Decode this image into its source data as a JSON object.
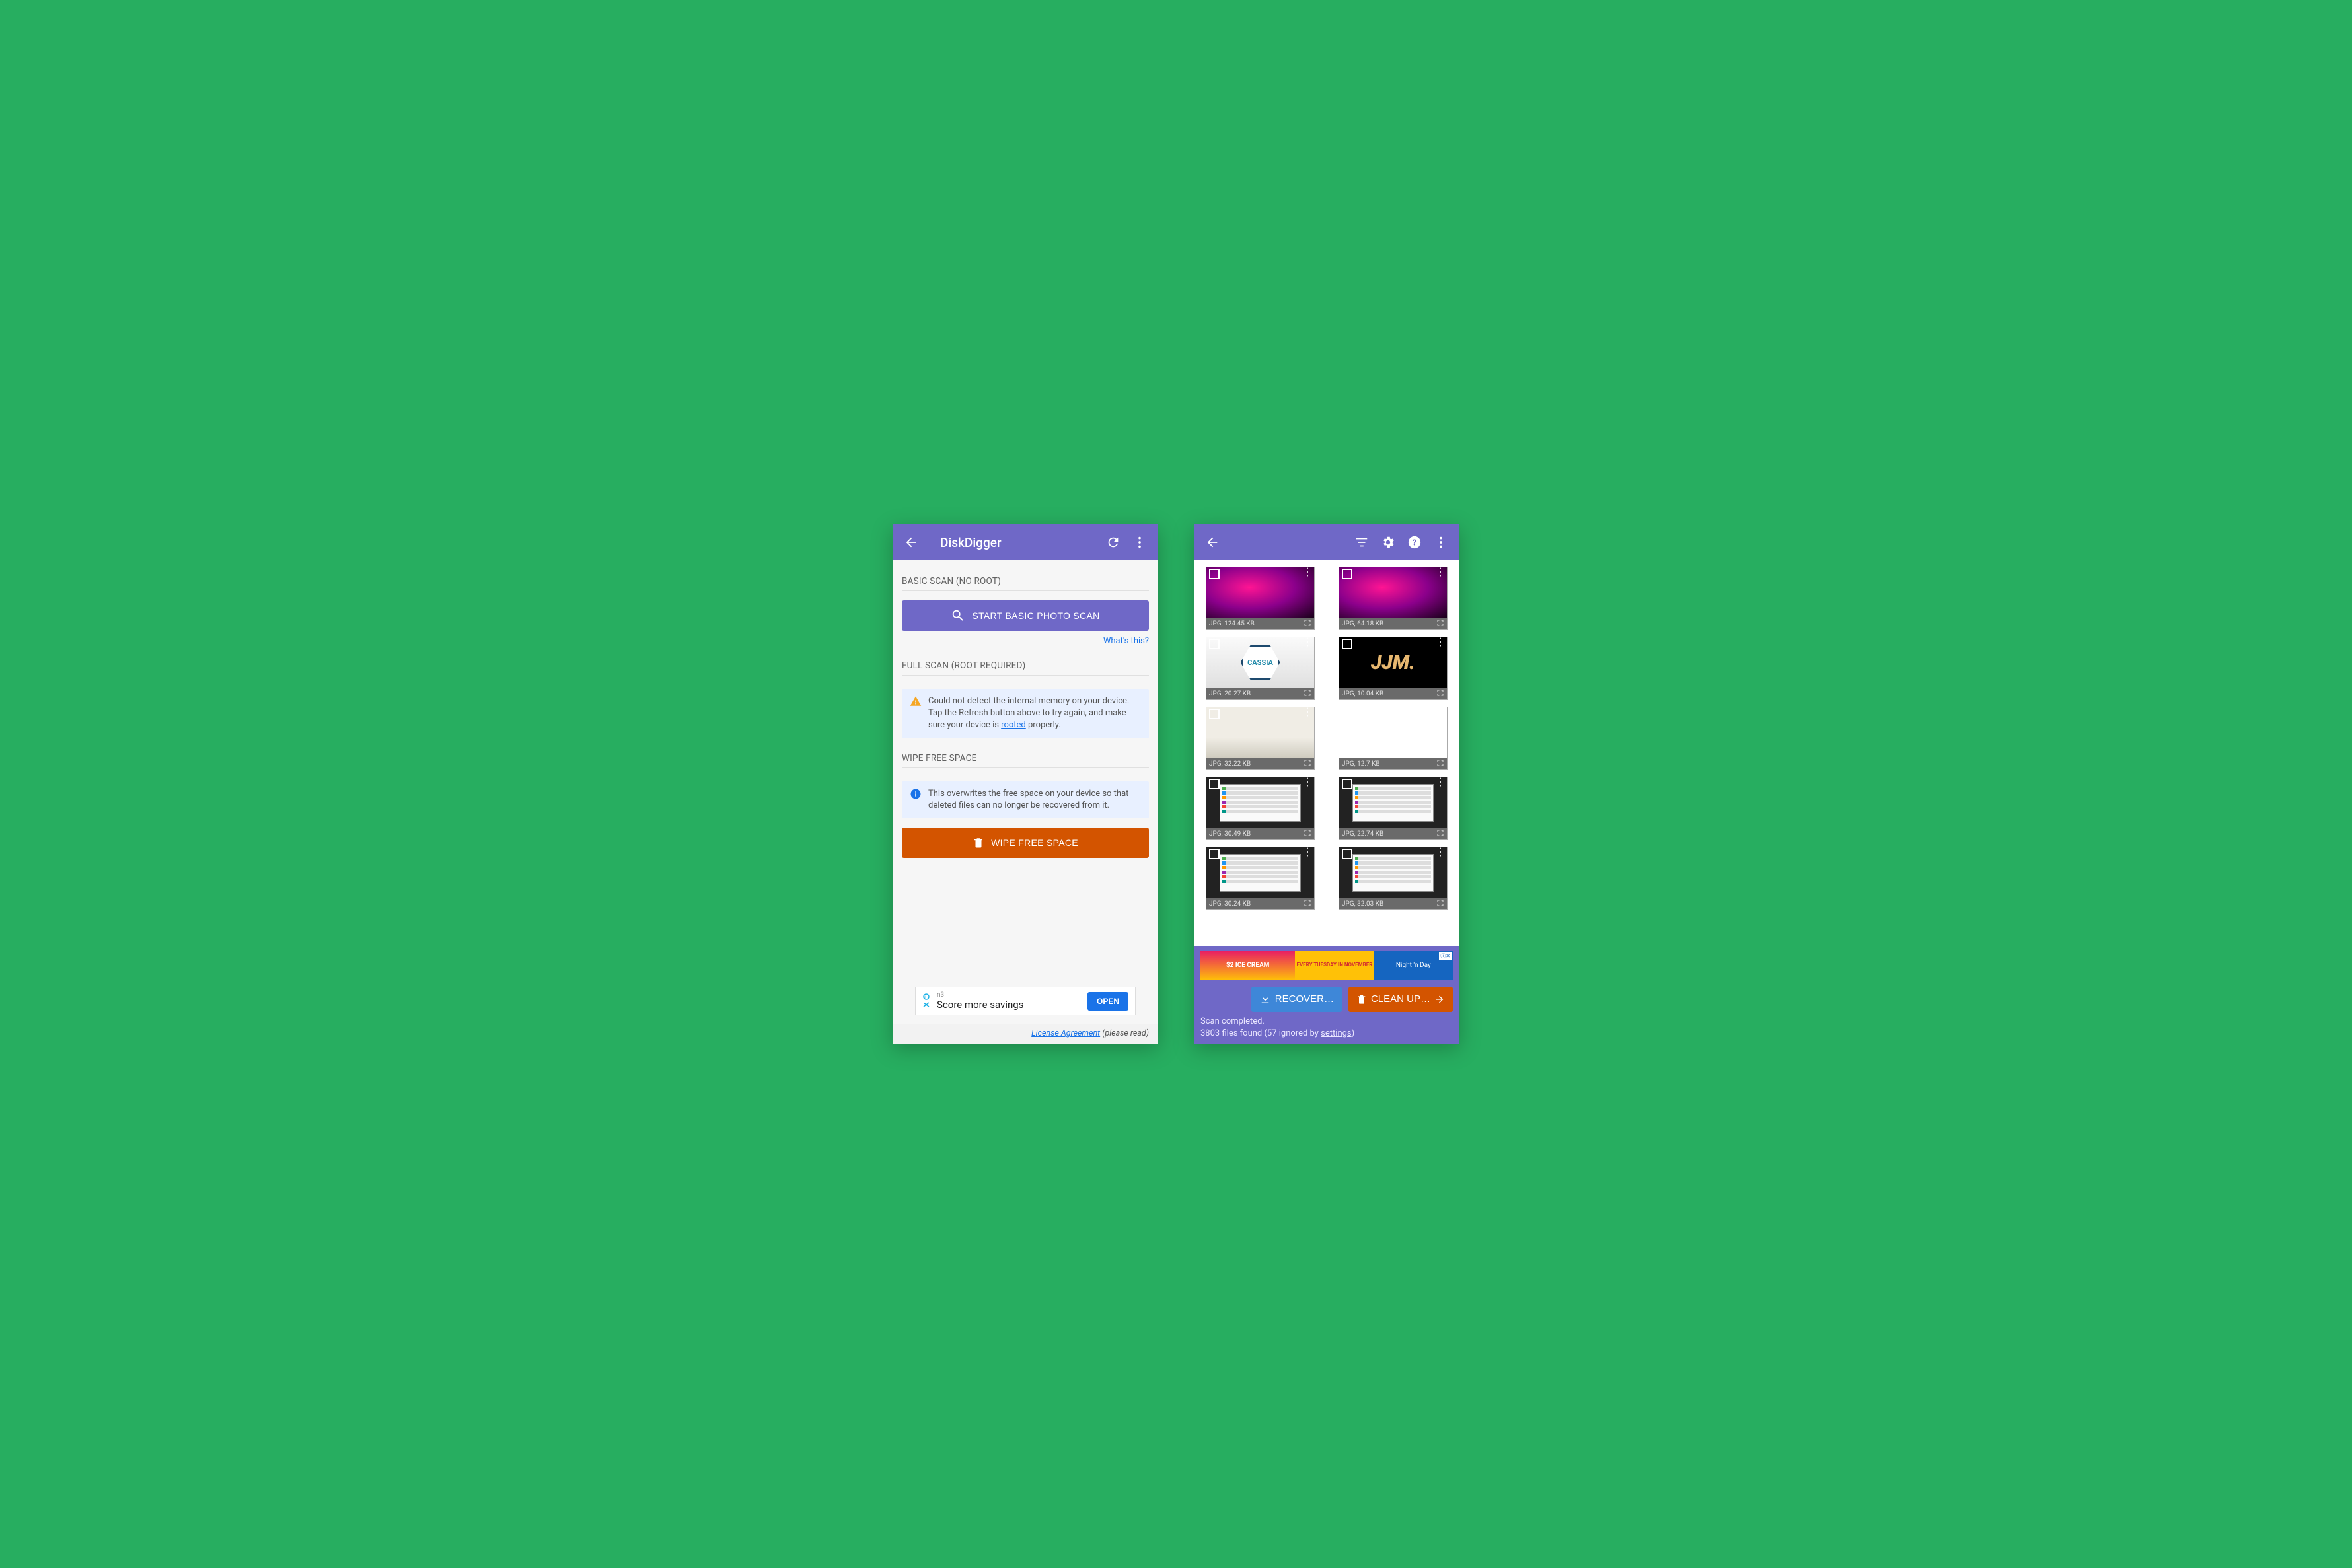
{
  "left": {
    "app_title": "DiskDigger",
    "basic": {
      "label": "BASIC SCAN (NO ROOT)",
      "button": "START BASIC PHOTO SCAN",
      "whats_this": "What's this?"
    },
    "full": {
      "label": "FULL SCAN (ROOT REQUIRED)",
      "warn_pre": "Could not detect the internal memory on your device. Tap the Refresh button above to try again, and make sure your device is ",
      "warn_link": "rooted",
      "warn_post": " properly."
    },
    "wipe": {
      "label": "WIPE FREE SPACE",
      "info": "This overwrites the free space on your device so that deleted files can no longer be recovered from it.",
      "button": "WIPE FREE SPACE"
    },
    "ad": {
      "n3": "n3",
      "headline": "Score more savings",
      "open": "OPEN"
    },
    "license": {
      "link": "License Agreement",
      "suffix": " (please read)"
    }
  },
  "right": {
    "thumbs": [
      {
        "caption": "JPG, 124.45 KB",
        "style": "timg-magenta"
      },
      {
        "caption": "JPG, 64.18 KB",
        "style": "timg-magenta"
      },
      {
        "caption": "JPG, 20.27 KB",
        "style": "timg-cassia",
        "text": "CASSIA"
      },
      {
        "caption": "JPG, 10.04 KB",
        "style": "timg-jjm",
        "text": "JJM."
      },
      {
        "caption": "JPG, 32.22 KB",
        "style": "timg-room"
      },
      {
        "caption": "JPG, 12.7 KB",
        "style": "timg-white"
      },
      {
        "caption": "JPG, 30.49 KB",
        "style": "timg-screenshot"
      },
      {
        "caption": "JPG, 22.74 KB",
        "style": "timg-screenshot"
      },
      {
        "caption": "JPG, 30.24 KB",
        "style": "timg-screenshot"
      },
      {
        "caption": "JPG, 32.03 KB",
        "style": "timg-screenshot"
      }
    ],
    "ad": {
      "seg1": "$2 ICE CREAM",
      "seg2": "EVERY TUESDAY IN NOVEMBER",
      "seg3": "Night 'n Day"
    },
    "recover": "RECOVER…",
    "cleanup": "CLEAN UP…",
    "status1": "Scan completed.",
    "status2_pre": "3803 files found (57 ignored by ",
    "status2_link": "settings",
    "status2_post": ")"
  }
}
